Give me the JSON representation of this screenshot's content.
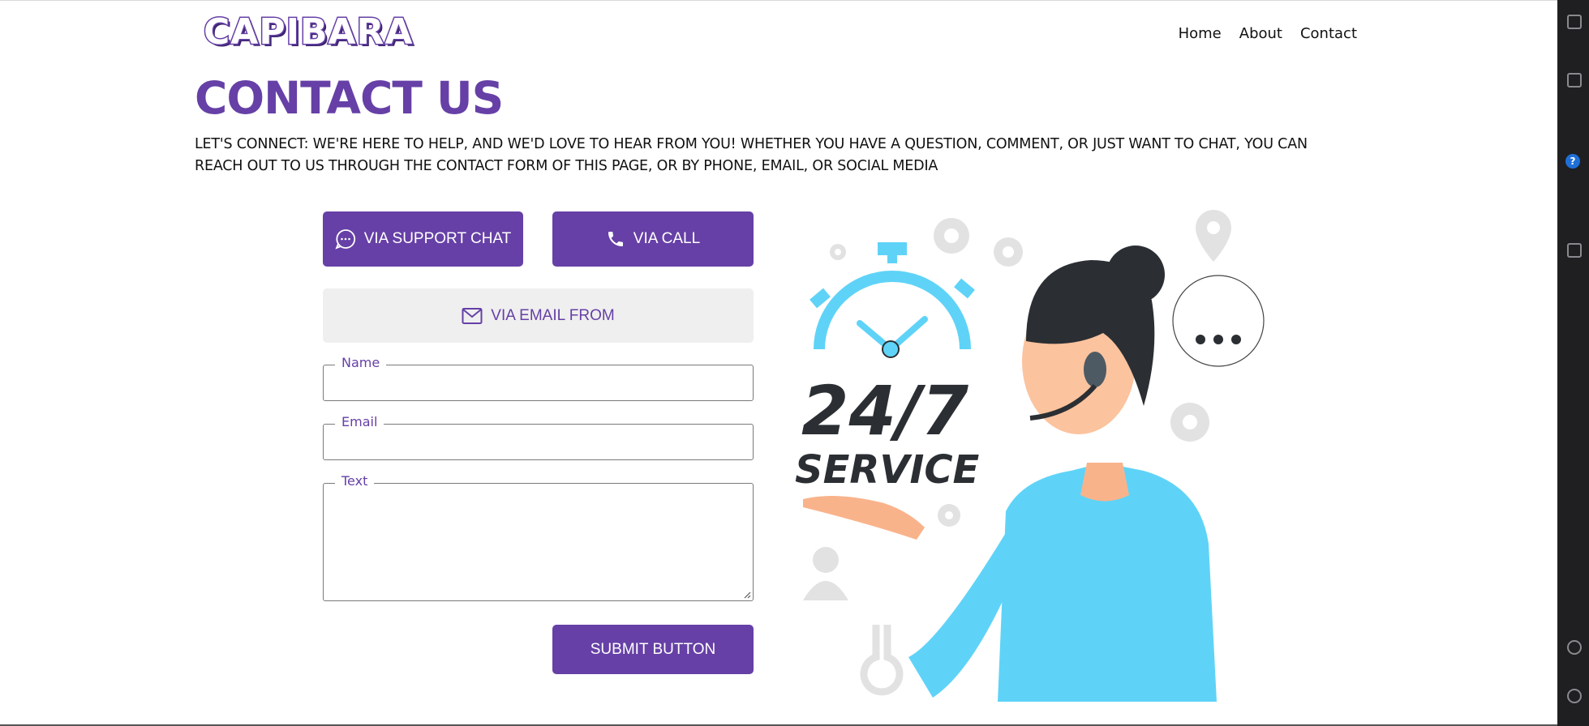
{
  "brand": {
    "logo_text": "CAPIBARA"
  },
  "nav": {
    "items": [
      {
        "label": "Home"
      },
      {
        "label": "About"
      },
      {
        "label": "Contact"
      }
    ]
  },
  "page": {
    "title": "CONTACT US",
    "intro": "LET'S CONNECT: WE'RE HERE TO HELP, AND WE'D LOVE TO HEAR FROM YOU! WHETHER YOU HAVE A QUESTION, COMMENT, OR JUST WANT TO CHAT, YOU CAN REACH OUT TO US THROUGH THE CONTACT FORM OF THIS PAGE, OR BY PHONE, EMAIL, OR SOCIAL MEDIA"
  },
  "contact_options": {
    "chat_label": "VIA SUPPORT CHAT",
    "call_label": "VIA CALL",
    "email_label": "VIA EMAIL FROM"
  },
  "form": {
    "name_label": "Name",
    "name_value": "",
    "email_label": "Email",
    "email_value": "",
    "text_label": "Text",
    "text_value": "",
    "submit_label": "SUBMIT BUTTON"
  },
  "illustration": {
    "line1": "24/7",
    "line2": "SERVICE"
  },
  "icons": {
    "chat": "chat-bubble-icon",
    "call": "phone-icon",
    "email": "envelope-icon"
  },
  "colors": {
    "accent": "#6640a6",
    "light_button": "#efefef",
    "illustration_blue": "#5fd3f7",
    "dark_text": "#2b2f33"
  }
}
